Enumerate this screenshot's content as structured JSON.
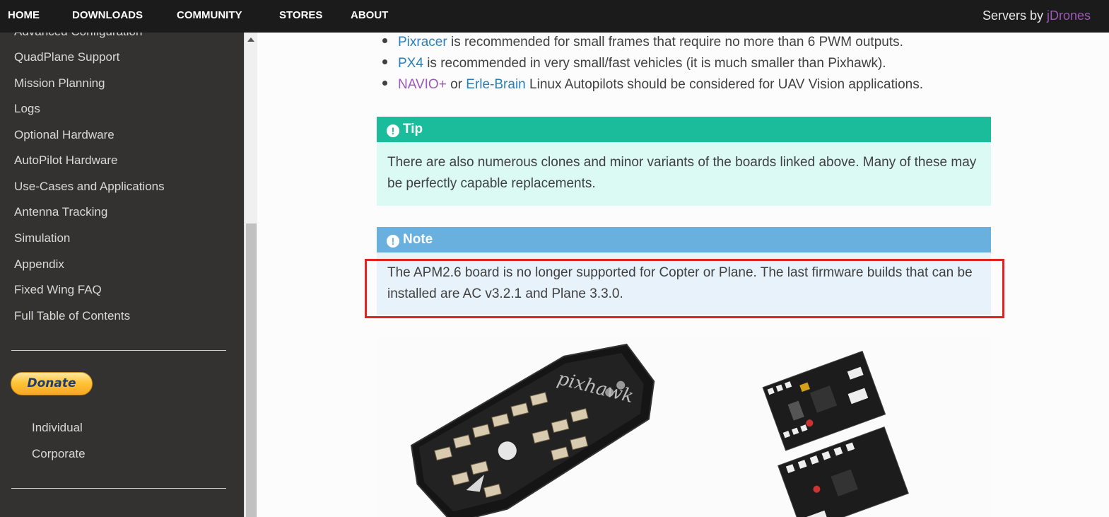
{
  "topnav": {
    "items": [
      "HOME",
      "DOWNLOADS",
      "COMMUNITY",
      "STORES",
      "ABOUT"
    ],
    "servers_prefix": "Servers by ",
    "servers_brand": "jDrones"
  },
  "sidebar": {
    "items": [
      "Advanced Configuration",
      "QuadPlane Support",
      "Mission Planning",
      "Logs",
      "Optional Hardware",
      "AutoPilot Hardware",
      "Use-Cases and Applications",
      "Antenna Tracking",
      "Simulation",
      "Appendix",
      "Fixed Wing FAQ",
      "Full Table of Contents"
    ],
    "donate_label": "Donate",
    "donate_options": [
      "Individual",
      "Corporate"
    ]
  },
  "content": {
    "bullets": [
      {
        "link": "Pixracer",
        "rest": " is recommended for small frames that require no more than 6 PWM outputs."
      },
      {
        "link": "PX4",
        "rest": " is recommended in very small/fast vehicles (it is much smaller than Pixhawk)."
      },
      {
        "link": "NAVIO+",
        "mid": " or ",
        "link2": "Erle-Brain",
        "rest": " Linux Autopilots should be considered for UAV Vision applications."
      }
    ],
    "tip": {
      "title": "Tip",
      "body": "There are also numerous clones and minor variants of the boards linked above. Many of these may be perfectly capable replacements."
    },
    "note": {
      "title": "Note",
      "body": "The APM2.6 board is no longer supported for Copter or Plane. The last firmware builds that can be installed are AC v3.2.1 and Plane 3.3.0."
    },
    "image_label": "pixhawk"
  },
  "colors": {
    "tip": "#1abc9c",
    "note": "#6ab0de",
    "highlight": "#e02424",
    "link": "#2980b9",
    "visited_link": "#9b59b6"
  }
}
